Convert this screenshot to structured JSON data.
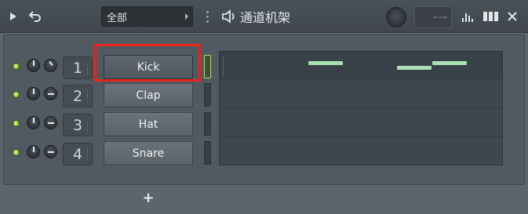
{
  "header": {
    "filter_label": "全部",
    "title": "通道机架"
  },
  "channels": [
    {
      "number": "1",
      "name": "Kick",
      "selected": true
    },
    {
      "number": "2",
      "name": "Clap",
      "selected": false
    },
    {
      "number": "3",
      "name": "Hat",
      "selected": false
    },
    {
      "number": "4",
      "name": "Snare",
      "selected": false
    }
  ],
  "colors": {
    "highlight": "#e8231c",
    "led": "#9ed44a",
    "note": "#a8e0b3"
  },
  "icons": {
    "play": "play-triangle-icon",
    "undo": "undo-icon",
    "speaker": "speaker-icon",
    "graph": "graph-bars-icon",
    "grid": "grid-icon",
    "close": "close-icon",
    "add": "plus-icon"
  },
  "add_label": "+"
}
